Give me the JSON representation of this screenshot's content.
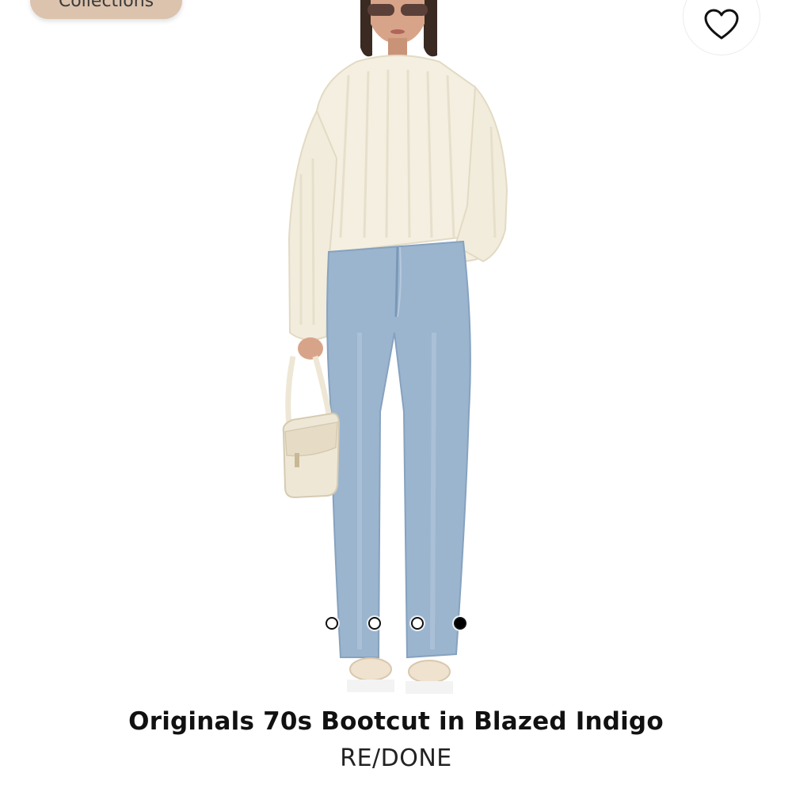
{
  "header": {
    "collections_label": "Collections"
  },
  "wishlist": {
    "icon": "heart-outline-icon"
  },
  "product": {
    "title": "Originals 70s Bootcut in Blazed Indigo",
    "brand": "RE/DONE",
    "image": {
      "description_icon": "model-photo",
      "colors": {
        "sweater": "#f4efe0",
        "jeans": "#9bb5cf",
        "bag": "#efe7d6",
        "skin": "#d8a489",
        "hair": "#3a2a22",
        "shoes": "#efe2cf"
      }
    }
  },
  "carousel": {
    "total": 4,
    "active_index": 3
  },
  "colors": {
    "pill_bg": "#dcc3ad",
    "dot_active": "#000000",
    "text_primary": "#111111"
  }
}
